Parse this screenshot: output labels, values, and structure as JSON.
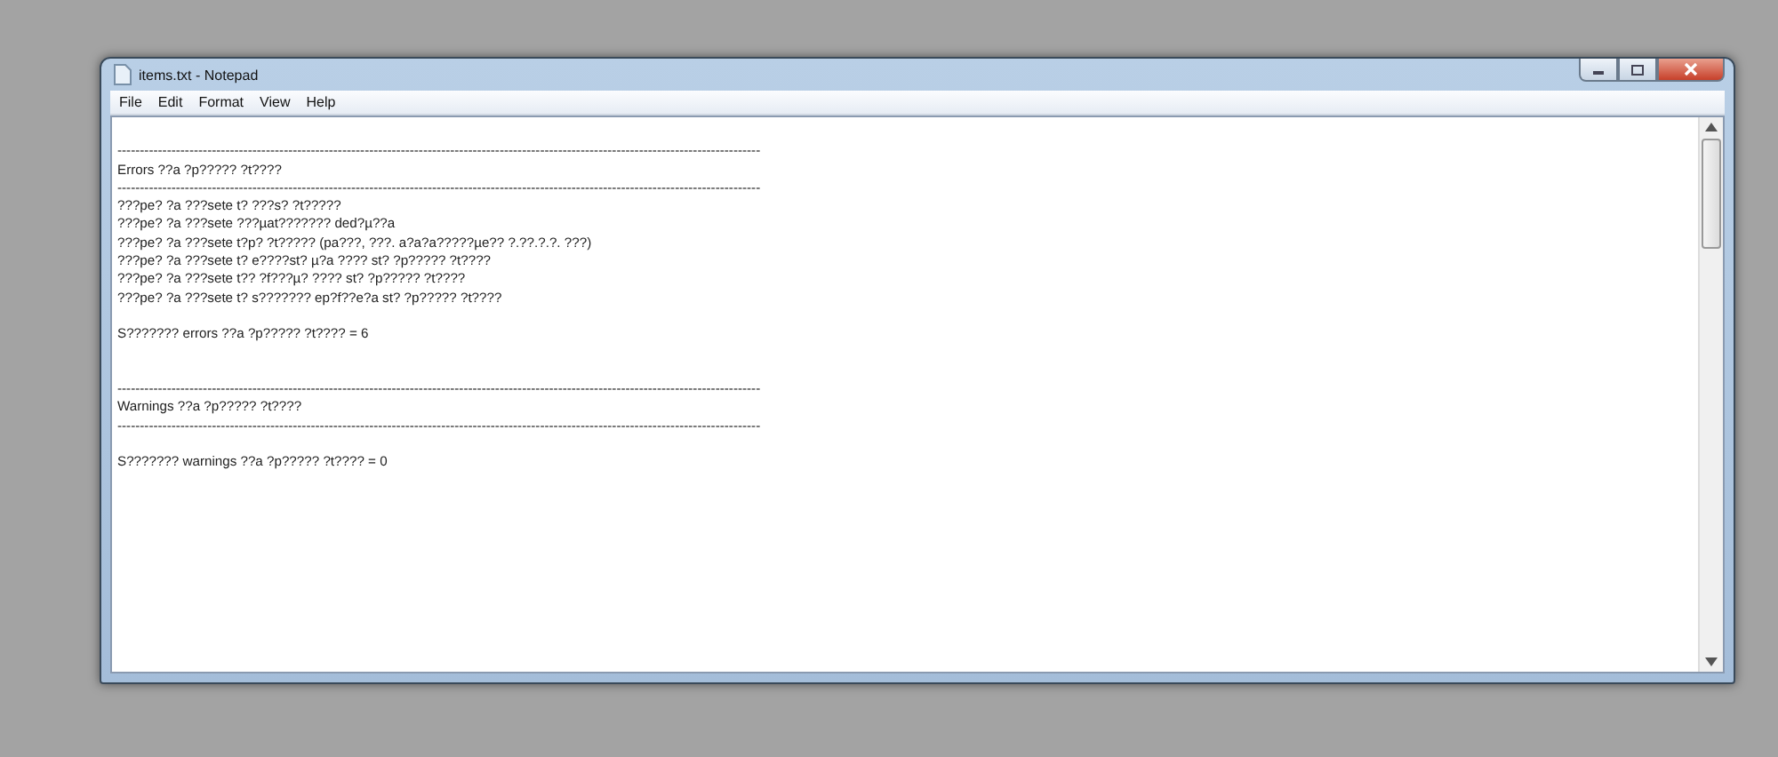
{
  "window": {
    "title": "items.txt - Notepad"
  },
  "menu": [
    {
      "label": "File"
    },
    {
      "label": "Edit"
    },
    {
      "label": "Format"
    },
    {
      "label": "View"
    },
    {
      "label": "Help"
    }
  ],
  "editor": {
    "lines": [
      {
        "kind": "blank"
      },
      {
        "kind": "text",
        "text": "-----------------------------------------------------------------------------------------------------------------------------------------------"
      },
      {
        "kind": "text",
        "text": "Errors ??a ?p????? ?t????"
      },
      {
        "kind": "text",
        "text": "-----------------------------------------------------------------------------------------------------------------------------------------------"
      },
      {
        "kind": "text",
        "text": "???pe? ?a ???sete t? ???s? ?t?????"
      },
      {
        "kind": "text",
        "text": "???pe? ?a ???sete ???µat??????? ded?µ??a"
      },
      {
        "kind": "text",
        "text": "???pe? ?a ???sete t?p? ?t????? (pa???, ???. a?a?a?????µe?? ?.??.?.?. ???)"
      },
      {
        "kind": "text",
        "text": "???pe? ?a ???sete t? e????st? µ?a ???? st? ?p????? ?t????"
      },
      {
        "kind": "text",
        "text": "???pe? ?a ???sete t?? ?f???µ? ???? st? ?p????? ?t????"
      },
      {
        "kind": "text",
        "text": "???pe? ?a ???sete t? s??????? ep?f??e?a st? ?p????? ?t????"
      },
      {
        "kind": "blank"
      },
      {
        "kind": "text",
        "text": "S??????? errors ??a ?p????? ?t???? = 6"
      },
      {
        "kind": "blank"
      },
      {
        "kind": "blank"
      },
      {
        "kind": "text",
        "text": "-----------------------------------------------------------------------------------------------------------------------------------------------"
      },
      {
        "kind": "text",
        "text": "Warnings ??a ?p????? ?t????"
      },
      {
        "kind": "text",
        "text": "-----------------------------------------------------------------------------------------------------------------------------------------------"
      },
      {
        "kind": "blank"
      },
      {
        "kind": "text",
        "text": "S??????? warnings ??a ?p????? ?t???? = 0"
      }
    ]
  }
}
